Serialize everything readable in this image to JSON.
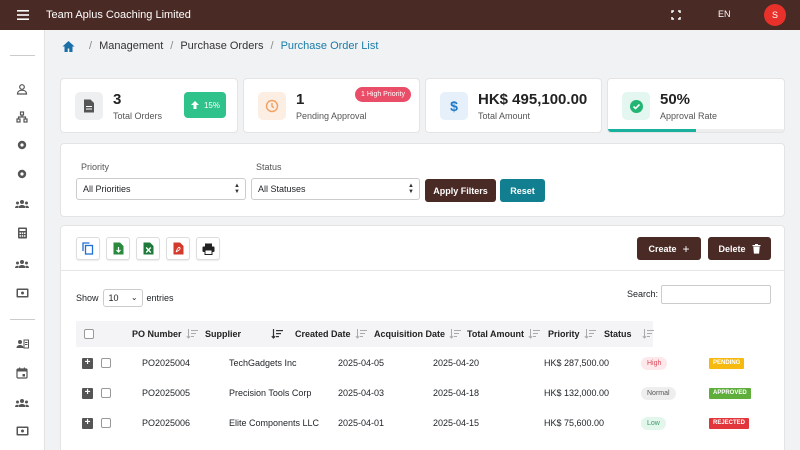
{
  "app": {
    "title": "Team Aplus Coaching Limited",
    "lang": "EN",
    "avatar_letter": "S",
    "accent": "#4a2a24"
  },
  "breadcrumb": {
    "items": [
      "Management",
      "Purchase Orders",
      "Purchase Order List"
    ]
  },
  "stats": [
    {
      "value": "3",
      "label": "Total Orders",
      "growth": "15%"
    },
    {
      "value": "1",
      "label": "Pending Approval",
      "badge": "1 High Priority"
    },
    {
      "value": "HK$ 495,100.00",
      "label": "Total Amount"
    },
    {
      "value": "50%",
      "label": "Approval Rate",
      "progress": 0.5
    }
  ],
  "filters": {
    "priority_label": "Priority",
    "priority_value": "All Priorities",
    "status_label": "Status",
    "status_value": "All Statuses",
    "apply_label": "Apply Filters",
    "reset_label": "Reset"
  },
  "toolbar": {
    "create_label": "Create",
    "delete_label": "Delete",
    "export_icons": [
      "copy-icon",
      "csv-icon",
      "excel-icon",
      "pdf-icon",
      "print-icon"
    ]
  },
  "table": {
    "show_label": "Show",
    "page_length": "10",
    "entries_label": "entries",
    "search_label": "Search:",
    "columns": [
      "PO Number",
      "Supplier",
      "Created Date",
      "Acquisition Date",
      "Total Amount",
      "Priority",
      "Status"
    ],
    "rows": [
      {
        "po": "PO2025004",
        "supplier": "TechGadgets Inc",
        "created": "2025-04-05",
        "acquisition": "2025-04-20",
        "amount": "HK$ 287,500.00",
        "priority": "High",
        "status": "PENDING"
      },
      {
        "po": "PO2025005",
        "supplier": "Precision Tools Corp",
        "created": "2025-04-03",
        "acquisition": "2025-04-18",
        "amount": "HK$ 132,000.00",
        "priority": "Normal",
        "status": "APPROVED"
      },
      {
        "po": "PO2025006",
        "supplier": "Elite Components LLC",
        "created": "2025-04-01",
        "acquisition": "2025-04-15",
        "amount": "HK$ 75,600.00",
        "priority": "Low",
        "status": "REJECTED"
      }
    ]
  },
  "colors": {
    "high": "#fde8eb",
    "normal": "#eeeeee",
    "low": "#e3f6ec",
    "pending": "#f5b90f",
    "approved": "#5fae3c",
    "rejected": "#e2353b"
  }
}
